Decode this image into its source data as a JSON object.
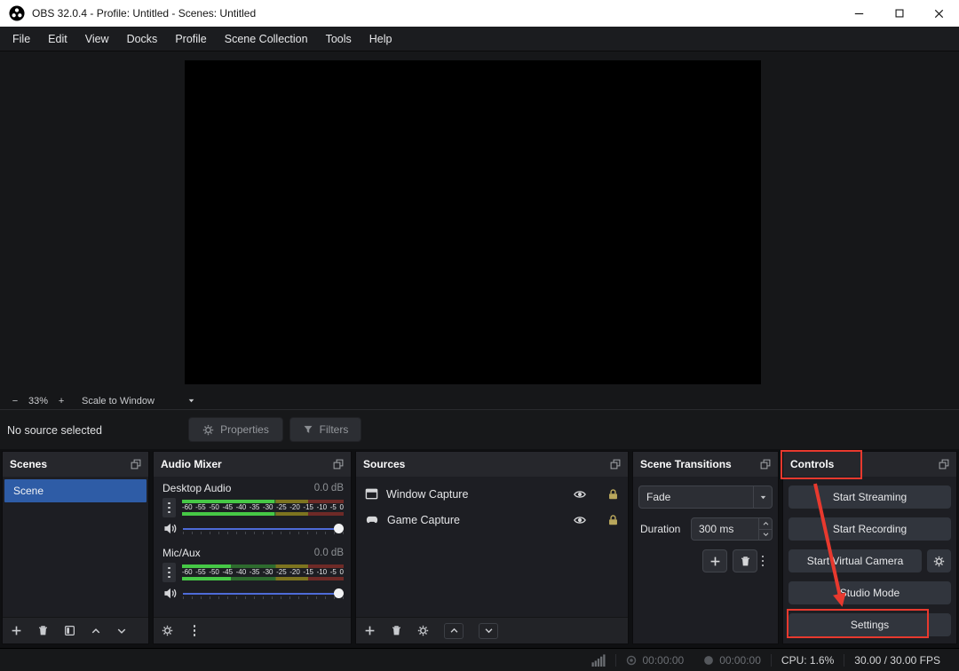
{
  "window": {
    "title": "OBS 32.0.4 - Profile: Untitled - Scenes: Untitled"
  },
  "menu": {
    "items": [
      "File",
      "Edit",
      "View",
      "Docks",
      "Profile",
      "Scene Collection",
      "Tools",
      "Help"
    ]
  },
  "preview": {
    "zoom_out_label": "−",
    "zoom_level": "33%",
    "zoom_in_label": "+",
    "scale_mode": "Scale to Window"
  },
  "source_toolbar": {
    "status_text": "No source selected",
    "properties_label": "Properties",
    "filters_label": "Filters"
  },
  "scenes_dock": {
    "title": "Scenes",
    "items": [
      {
        "label": "Scene",
        "selected": true
      }
    ]
  },
  "audio_mixer_dock": {
    "title": "Audio Mixer",
    "mixers": [
      {
        "name": "Desktop Audio",
        "volume_db": "0.0 dB",
        "level_percent": 57,
        "scale_ticks": [
          "-60",
          "-55",
          "-50",
          "-45",
          "-40",
          "-35",
          "-30",
          "-25",
          "-20",
          "-15",
          "-10",
          "-5",
          "0"
        ]
      },
      {
        "name": "Mic/Aux",
        "volume_db": "0.0 dB",
        "level_percent": 30,
        "scale_ticks": [
          "-60",
          "-55",
          "-50",
          "-45",
          "-40",
          "-35",
          "-30",
          "-25",
          "-20",
          "-15",
          "-10",
          "-5",
          "0"
        ]
      }
    ]
  },
  "sources_dock": {
    "title": "Sources",
    "items": [
      {
        "label": "Window Capture",
        "visible": true,
        "locked": true
      },
      {
        "label": "Game Capture",
        "visible": true,
        "locked": true
      }
    ]
  },
  "transitions_dock": {
    "title": "Scene Transitions",
    "transition": "Fade",
    "duration_label": "Duration",
    "duration_value": "300 ms"
  },
  "controls_dock": {
    "title": "Controls",
    "buttons": {
      "start_streaming": "Start Streaming",
      "start_recording": "Start Recording",
      "start_virtual_camera": "Start Virtual Camera",
      "studio_mode": "Studio Mode",
      "settings": "Settings"
    }
  },
  "status_bar": {
    "rec_timer": "00:00:00",
    "stream_timer": "00:00:00",
    "cpu": "CPU: 1.6%",
    "fps": "30.00 / 30.00 FPS"
  },
  "icons": {
    "gear": "gear",
    "trash": "trash-can",
    "plus": "plus",
    "eye": "visibility-eye",
    "lock": "padlock",
    "funnel": "filter-funnel",
    "popout": "dock-popout",
    "kebab": "more-vertical-dots",
    "speaker": "audio-speaker",
    "signal": "network-bars"
  },
  "theme": {
    "selection": "#2e5ca6",
    "annotation": "#e8392e",
    "slider": "#4e6bd8",
    "meter_green": "#46c846"
  }
}
